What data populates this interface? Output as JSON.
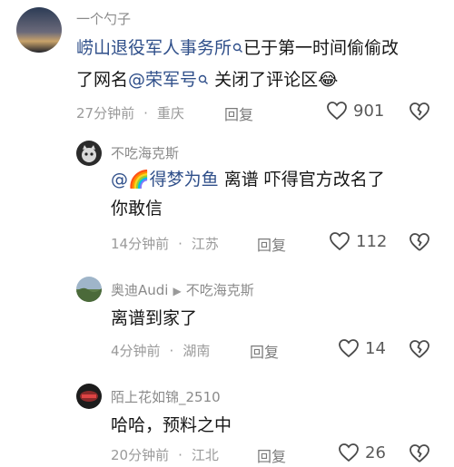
{
  "comments": [
    {
      "username": "一个勺子",
      "line1": {
        "mention": "崂山退役军人事务所",
        "rest": "已于第一时间偷偷改"
      },
      "line2": {
        "pre": "了网名",
        "mention": "@荣军号",
        "rest": " 关闭了评论区",
        "emoji": "😂"
      },
      "time": "27分钟前",
      "location": "重庆",
      "reply": "回复",
      "likes": "901"
    },
    {
      "username": "不吃海克斯",
      "line1": {
        "at": "@",
        "emoji": "🌈",
        "mention": "得梦为鱼",
        "rest": " 离谱  吓得官方改名了"
      },
      "line2": {
        "text": "你敢信"
      },
      "time": "14分钟前",
      "location": "江苏",
      "reply": "回复",
      "likes": "112"
    },
    {
      "username": "奥迪Audi",
      "reply_to": "不吃海克斯",
      "line1": {
        "text": "离谱到家了"
      },
      "time": "4分钟前",
      "location": "湖南",
      "reply": "回复",
      "likes": "14"
    },
    {
      "username": "陌上花如锦_2510",
      "line1": {
        "text": "哈哈，预料之中"
      },
      "time": "20分钟前",
      "location": "江北",
      "reply": "回复",
      "likes": "26"
    }
  ]
}
